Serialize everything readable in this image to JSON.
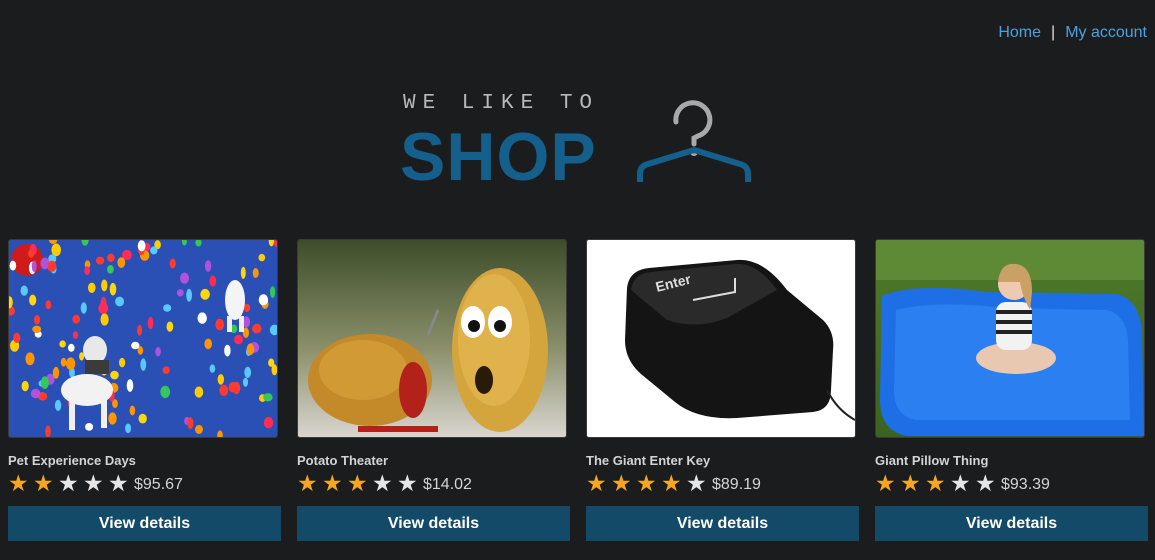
{
  "nav": {
    "home_label": "Home",
    "separator": "|",
    "account_label": "My account"
  },
  "logo": {
    "tagline": "WE LIKE TO",
    "wordmark": "SHOP",
    "icon": "hanger-icon"
  },
  "colors": {
    "background": "#1b1c1e",
    "link": "#4aa3e0",
    "brand": "#145f8c",
    "button": "#124a68",
    "star_on": "#f5a623",
    "star_off": "#e6e6e6"
  },
  "products": [
    {
      "name": "Pet Experience Days",
      "rating": 2,
      "price": "$95.67",
      "button_label": "View details",
      "image": "balloons-dogs-image"
    },
    {
      "name": "Potato Theater",
      "rating": 3,
      "price": "$14.02",
      "button_label": "View details",
      "image": "potatoes-image"
    },
    {
      "name": "The Giant Enter Key",
      "rating": 4,
      "price": "$89.19",
      "button_label": "View details",
      "image": "enter-key-image"
    },
    {
      "name": "Giant Pillow Thing",
      "rating": 3,
      "price": "$93.39",
      "button_label": "View details",
      "image": "pillow-image"
    }
  ]
}
